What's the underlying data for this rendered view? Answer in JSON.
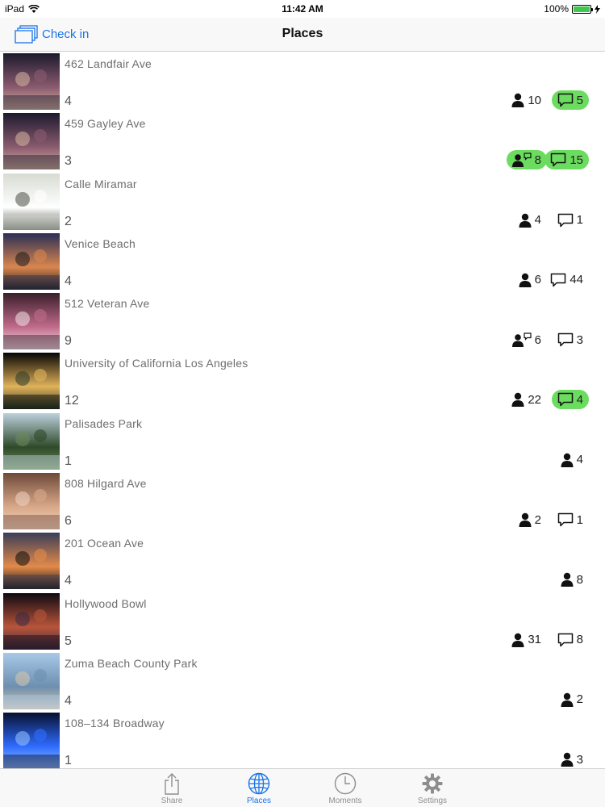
{
  "status_bar": {
    "device": "iPad",
    "time": "11:42 AM",
    "battery": "100%",
    "battery_level": 1.0,
    "icons": [
      "wifi-icon",
      "battery-icon",
      "charging-icon"
    ]
  },
  "nav": {
    "checkin_label": "Check in",
    "checkin_icon": "stacked-windows-icon",
    "title": "Places"
  },
  "colors": {
    "accent": "#1a73e8",
    "highlight_green": "#6bdc5f",
    "secondary_text": "#6e6e6e"
  },
  "places": [
    {
      "name": "462 Landfair Ave",
      "count": "4",
      "thumb_icon": "party-photo",
      "stat1": {
        "icon": "person-icon",
        "value": "10",
        "highlight": false
      },
      "stat2": {
        "icon": "chat-bubble-icon",
        "value": "5",
        "highlight": true
      }
    },
    {
      "name": "459 Gayley Ave",
      "count": "3",
      "thumb_icon": "party-photo",
      "stat1": {
        "icon": "person-chat-icon",
        "value": "8",
        "highlight": true
      },
      "stat2": {
        "icon": "chat-bubble-icon",
        "value": "15",
        "highlight": true
      }
    },
    {
      "name": "Calle Miramar",
      "count": "2",
      "thumb_icon": "people-photo",
      "stat1": {
        "icon": "person-icon",
        "value": "4",
        "highlight": false
      },
      "stat2": {
        "icon": "chat-bubble-icon",
        "value": "1",
        "highlight": false
      }
    },
    {
      "name": "Venice Beach",
      "count": "4",
      "thumb_icon": "sunset-photo",
      "stat1": {
        "icon": "person-icon",
        "value": "6",
        "highlight": false
      },
      "stat2": {
        "icon": "chat-bubble-icon",
        "value": "44",
        "highlight": false
      }
    },
    {
      "name": "512 Veteran Ave",
      "count": "9",
      "thumb_icon": "concert-photo",
      "stat1": {
        "icon": "person-chat-icon",
        "value": "6",
        "highlight": false
      },
      "stat2": {
        "icon": "chat-bubble-icon",
        "value": "3",
        "highlight": false
      }
    },
    {
      "name": "University of California Los Angeles",
      "count": "12",
      "thumb_icon": "night-event-photo",
      "stat1": {
        "icon": "person-icon",
        "value": "22",
        "highlight": false
      },
      "stat2": {
        "icon": "chat-bubble-icon",
        "value": "4",
        "highlight": true
      }
    },
    {
      "name": "Palisades Park",
      "count": "1",
      "thumb_icon": "trees-photo",
      "stat1": null,
      "stat2": {
        "icon": "person-icon",
        "value": "4",
        "highlight": false
      }
    },
    {
      "name": "808 Hilgard Ave",
      "count": "6",
      "thumb_icon": "selfie-photo",
      "stat1": {
        "icon": "person-icon",
        "value": "2",
        "highlight": false
      },
      "stat2": {
        "icon": "chat-bubble-icon",
        "value": "1",
        "highlight": false
      }
    },
    {
      "name": "201 Ocean Ave",
      "count": "4",
      "thumb_icon": "palm-sunset-photo",
      "stat1": null,
      "stat2": {
        "icon": "person-icon",
        "value": "8",
        "highlight": false
      }
    },
    {
      "name": "Hollywood Bowl",
      "count": "5",
      "thumb_icon": "venue-photo",
      "stat1": {
        "icon": "person-icon",
        "value": "31",
        "highlight": false
      },
      "stat2": {
        "icon": "chat-bubble-icon",
        "value": "8",
        "highlight": false
      }
    },
    {
      "name": "Zuma Beach County Park",
      "count": "4",
      "thumb_icon": "beach-photo",
      "stat1": null,
      "stat2": {
        "icon": "person-icon",
        "value": "2",
        "highlight": false
      }
    },
    {
      "name": "108–134 Broadway",
      "count": "1",
      "thumb_icon": "blue-lights-photo",
      "stat1": null,
      "stat2": {
        "icon": "person-icon",
        "value": "3",
        "highlight": false
      }
    }
  ],
  "tabs": [
    {
      "label": "Share",
      "icon": "share-icon",
      "active": false
    },
    {
      "label": "Places",
      "icon": "globe-icon",
      "active": true
    },
    {
      "label": "Moments",
      "icon": "clock-icon",
      "active": false
    },
    {
      "label": "Settings",
      "icon": "gear-icon",
      "active": false
    }
  ]
}
